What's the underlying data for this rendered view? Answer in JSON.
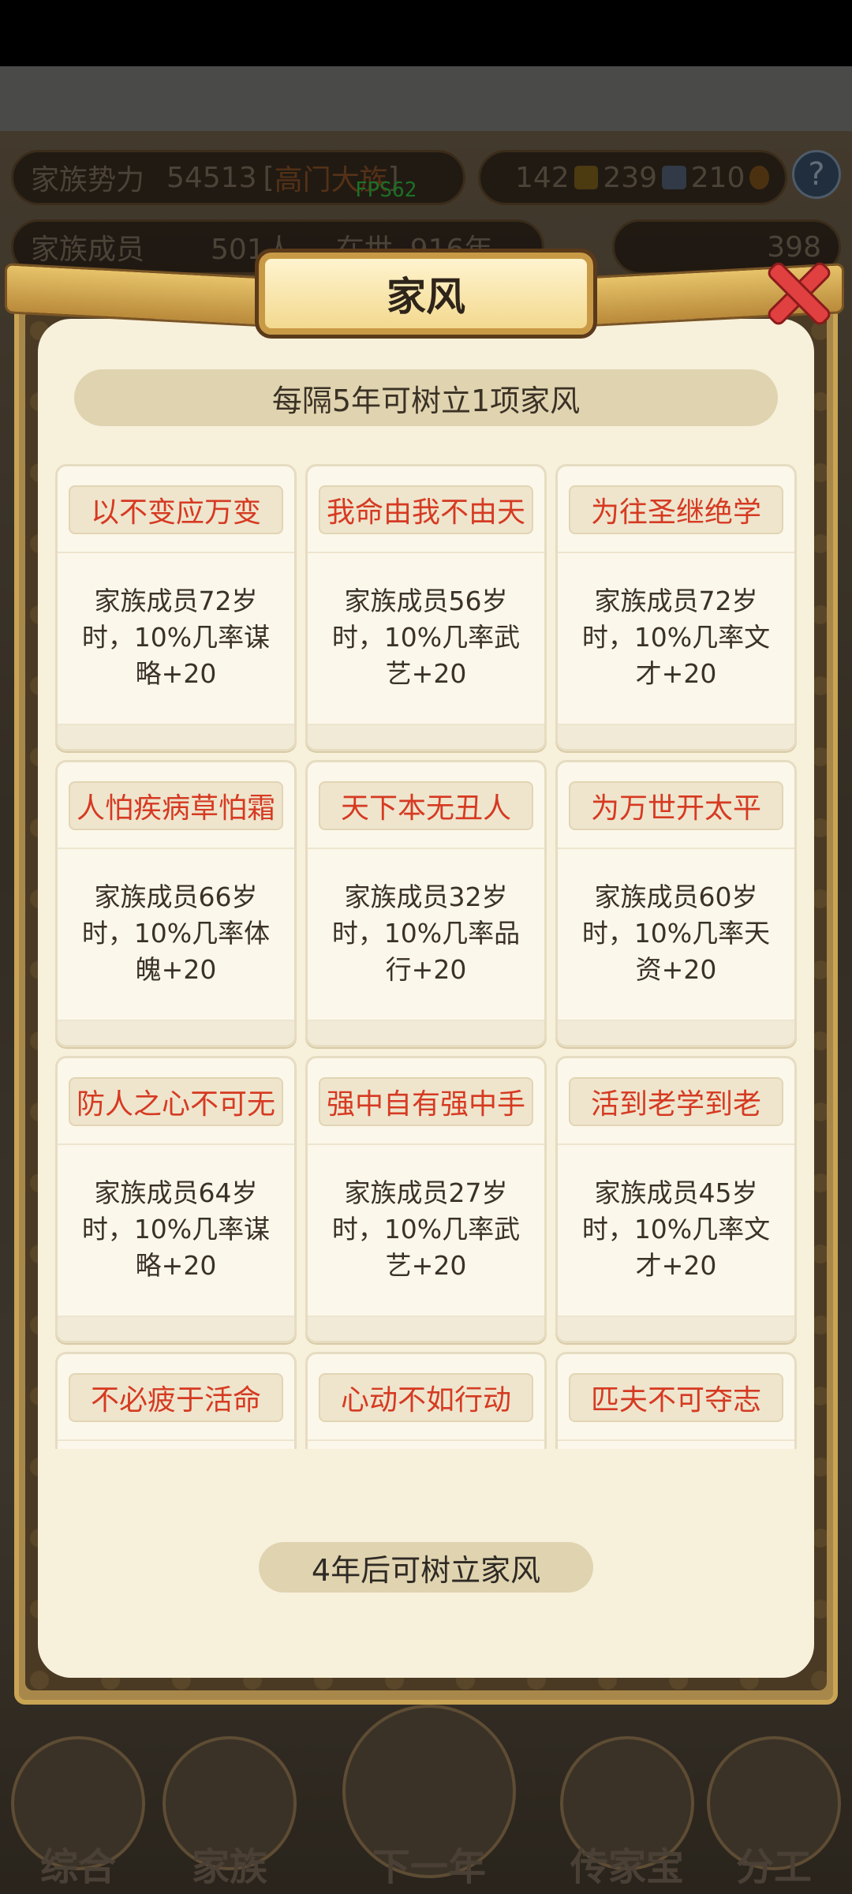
{
  "hud": {
    "power_label": "家族势力",
    "power_value": "54513",
    "rank_open": "[",
    "rank": "高门大族",
    "rank_close": "]",
    "fps": "FPS62",
    "res1": "142",
    "res2": "239",
    "res3": "210",
    "help": "?",
    "members_label": "家族成员",
    "members_value": "501人",
    "alive_label": "在世",
    "alive_value": "916年",
    "gold_value": "398"
  },
  "dialog": {
    "title": "家风",
    "subtitle": "每隔5年可树立1项家风",
    "status": "4年后可树立家风"
  },
  "mottos": [
    {
      "name": "以不变应万变",
      "desc": "家族成员72岁时，10%几率谋略+20"
    },
    {
      "name": "我命由我不由天",
      "desc": "家族成员56岁时，10%几率武艺+20"
    },
    {
      "name": "为往圣继绝学",
      "desc": "家族成员72岁时，10%几率文才+20"
    },
    {
      "name": "人怕疾病草怕霜",
      "desc": "家族成员66岁时，10%几率体魄+20"
    },
    {
      "name": "天下本无丑人",
      "desc": "家族成员32岁时，10%几率品行+20"
    },
    {
      "name": "为万世开太平",
      "desc": "家族成员60岁时，10%几率天资+20"
    },
    {
      "name": "防人之心不可无",
      "desc": "家族成员64岁时，10%几率谋略+20"
    },
    {
      "name": "强中自有强中手",
      "desc": "家族成员27岁时，10%几率武艺+20"
    },
    {
      "name": "活到老学到老",
      "desc": "家族成员45岁时，10%几率文才+20"
    },
    {
      "name": "不必疲于活命",
      "desc": ""
    },
    {
      "name": "心动不如行动",
      "desc": ""
    },
    {
      "name": "匹夫不可夺志",
      "desc": ""
    }
  ],
  "nav": {
    "general": "综合",
    "family": "家族",
    "next_year": "下一年",
    "heirloom": "传家宝",
    "division": "分工"
  },
  "colors": {
    "motto_name": "#d63a22",
    "card_bg": "#fbf7ea",
    "panel_bg": "#f7f0db",
    "fps": "#33cc44"
  }
}
